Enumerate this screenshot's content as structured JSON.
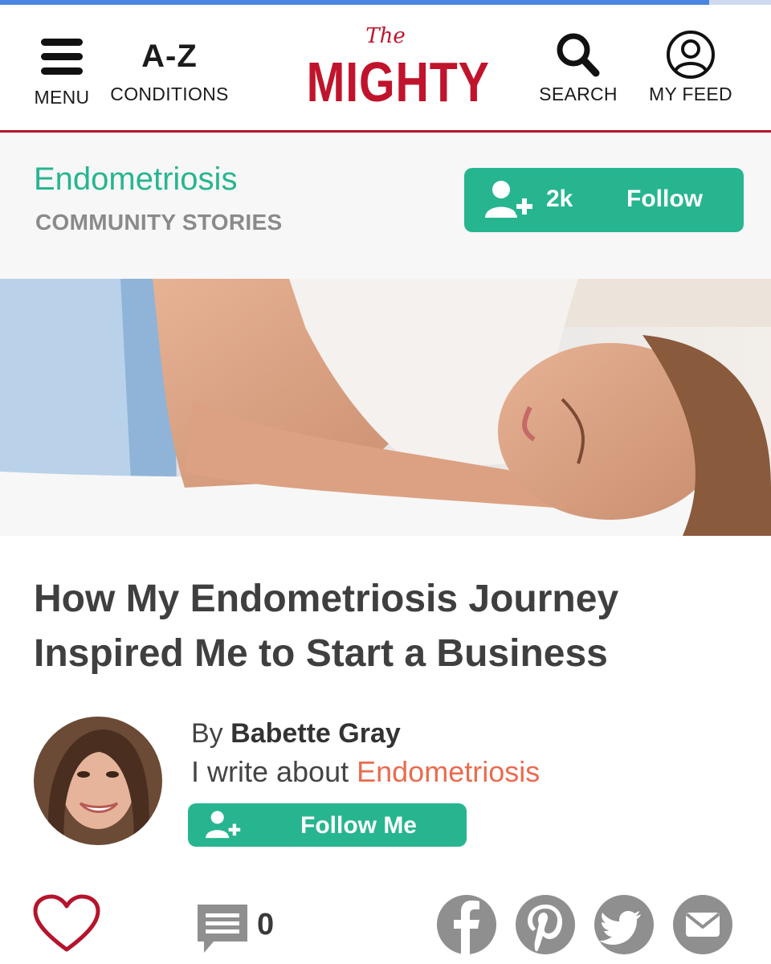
{
  "loading_progress": 0.92,
  "header": {
    "menu_label": "MENU",
    "az_text": "A-Z",
    "conditions_label": "CONDITIONS",
    "logo_small": "The",
    "logo_main": "MIGHTY",
    "search_label": "SEARCH",
    "feed_label": "MY FEED"
  },
  "community": {
    "name": "Endometriosis",
    "subtitle": "COMMUNITY STORIES",
    "follower_count": "2k",
    "follow_label": "Follow"
  },
  "article": {
    "title": "How My Endometriosis Journey Inspired Me to Start a Business",
    "by_prefix": "By",
    "author": "Babette Gray",
    "writes_prefix": "I write about",
    "writes_topic": "Endometriosis",
    "follow_me_label": "Follow Me",
    "comment_count": "0"
  },
  "icons": {
    "menu": "hamburger-icon",
    "search": "search-icon",
    "feed": "user-circle-icon",
    "follow": "add-user-icon",
    "like": "heart-icon",
    "comment": "comment-icon",
    "share": [
      "facebook-icon",
      "pinterest-icon",
      "twitter-icon",
      "email-icon"
    ]
  },
  "colors": {
    "brand_red": "#c0142c",
    "accent_green": "#27b590",
    "topic_orange": "#ea6b4f",
    "share_gray": "#8f8f8f"
  }
}
